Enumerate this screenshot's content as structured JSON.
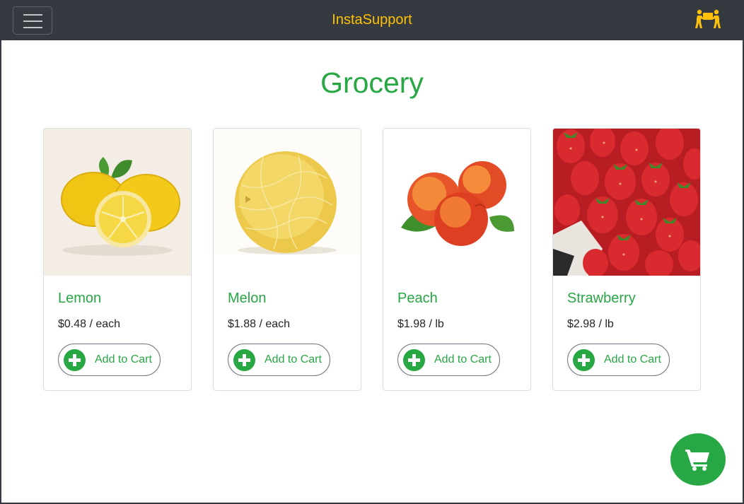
{
  "navbar": {
    "brand": "InstaSupport",
    "menu_icon": "hamburger-menu-icon",
    "help_icon": "people-carry-icon",
    "accent_color": "#ffc107",
    "background_color": "#343a40"
  },
  "page": {
    "title": "Grocery",
    "title_color": "#28a745"
  },
  "products": [
    {
      "name": "Lemon",
      "price": "$0.48 / each",
      "image": "lemon-image",
      "button_label": "Add to Cart"
    },
    {
      "name": "Melon",
      "price": "$1.88 / each",
      "image": "melon-image",
      "button_label": "Add to Cart"
    },
    {
      "name": "Peach",
      "price": "$1.98 / lb",
      "image": "peach-image",
      "button_label": "Add to Cart"
    },
    {
      "name": "Strawberry",
      "price": "$2.98 / lb",
      "image": "strawberry-image",
      "button_label": "Add to Cart"
    }
  ],
  "cart_button": {
    "icon": "shopping-cart-icon",
    "color": "#28a745"
  }
}
